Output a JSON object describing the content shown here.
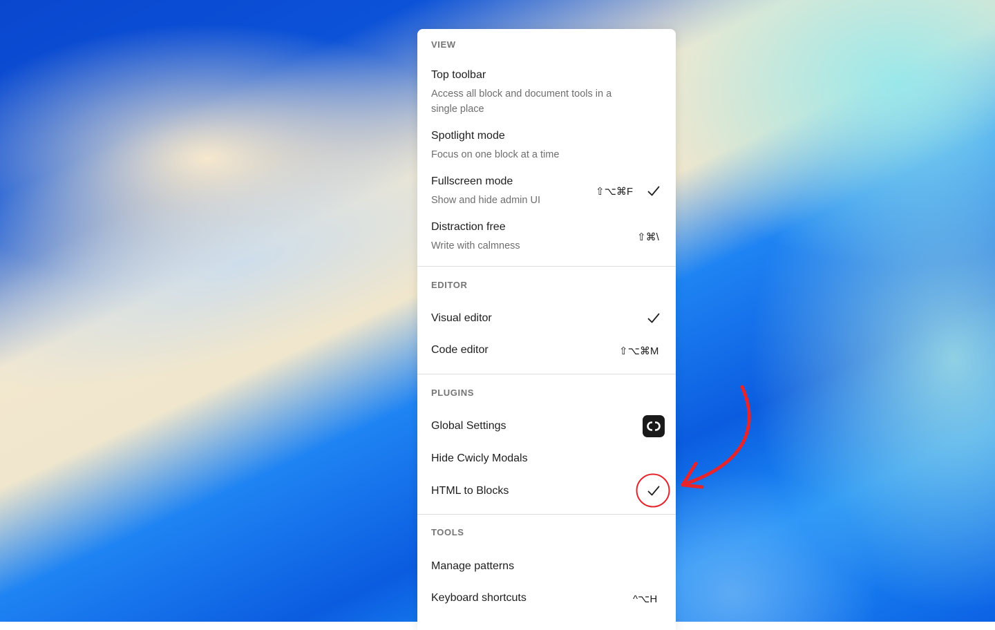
{
  "menu": {
    "view": {
      "title": "VIEW",
      "items": [
        {
          "label": "Top toolbar",
          "description": "Access all block and document tools in a single place"
        },
        {
          "label": "Spotlight mode",
          "description": "Focus on one block at a time"
        },
        {
          "label": "Fullscreen mode",
          "description": "Show and hide admin UI",
          "shortcut": "⇧⌥⌘F",
          "checked": true
        },
        {
          "label": "Distraction free",
          "description": "Write with calmness",
          "shortcut": "⇧⌘\\"
        }
      ]
    },
    "editor": {
      "title": "EDITOR",
      "items": [
        {
          "label": "Visual editor",
          "checked": true
        },
        {
          "label": "Code editor",
          "shortcut": "⇧⌥⌘M"
        }
      ]
    },
    "plugins": {
      "title": "PLUGINS",
      "items": [
        {
          "label": "Global Settings",
          "icon": "cwicly-logo-icon"
        },
        {
          "label": "Hide Cwicly Modals"
        },
        {
          "label": "HTML to Blocks",
          "checked": true
        }
      ]
    },
    "tools": {
      "title": "TOOLS",
      "items": [
        {
          "label": "Manage patterns"
        },
        {
          "label": "Keyboard shortcuts",
          "shortcut": "^⌥H"
        }
      ]
    }
  },
  "colors": {
    "annotation": "#e5242b",
    "menu_background": "#ffffff",
    "text_primary": "#1e1e1e",
    "text_secondary": "#6e6e6e"
  }
}
